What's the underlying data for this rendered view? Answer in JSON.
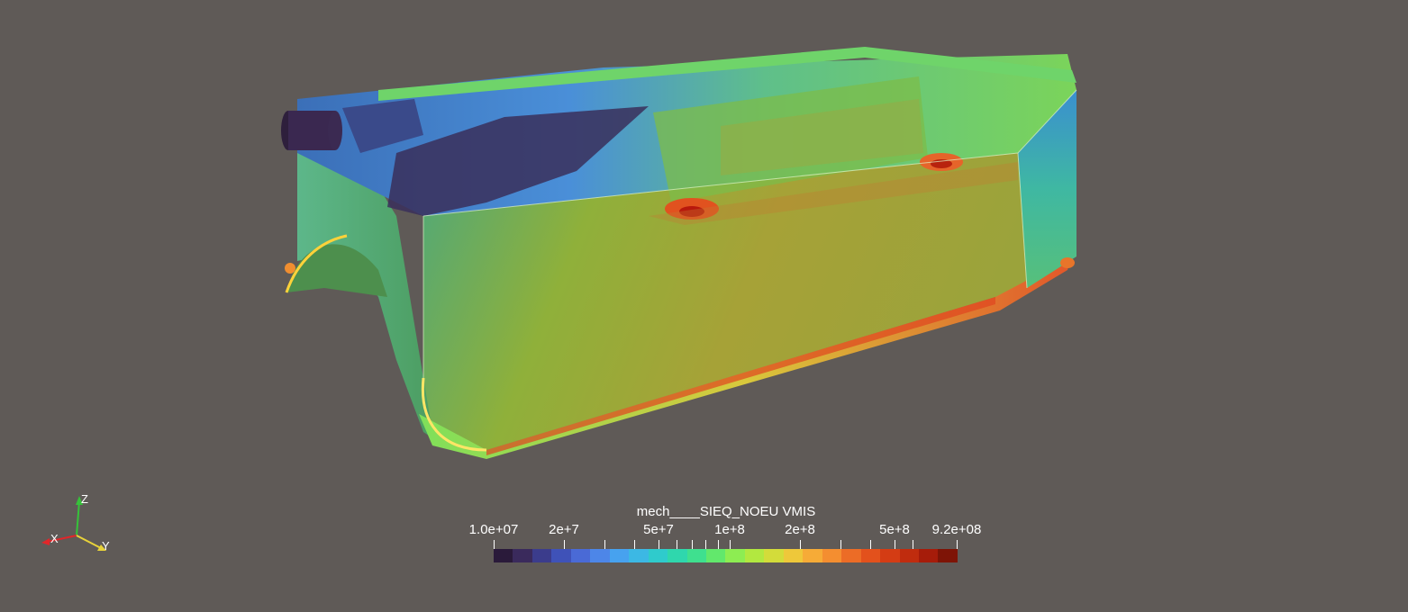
{
  "scalar_bar": {
    "title": "mech____SIEQ_NOEU VMIS",
    "min_label": "1.0e+07",
    "max_label": "9.2e+08",
    "labels": [
      "1.0e+07",
      "2e+7",
      "5e+7",
      "1e+8",
      "2e+8",
      "5e+8",
      "9.2e+08"
    ],
    "colors": [
      "#2a1a3a",
      "#3a2a5c",
      "#3b3c8c",
      "#3f52b8",
      "#4a6ad6",
      "#4d86e8",
      "#47a2ef",
      "#3cb8e4",
      "#2fcbcc",
      "#2fd7ad",
      "#3fe08f",
      "#62e86c",
      "#8ded52",
      "#b2e840",
      "#d3dc3a",
      "#eec83a",
      "#f6ab37",
      "#f48e30",
      "#ec6c26",
      "#e3511c",
      "#d43c14",
      "#c02c0e",
      "#a61c0a",
      "#7e1406"
    ]
  },
  "axes": {
    "x": "X",
    "y": "Y",
    "z": "Z",
    "colors": {
      "x": "#e0262a",
      "y": "#e8d23a",
      "z": "#36c23a"
    }
  }
}
